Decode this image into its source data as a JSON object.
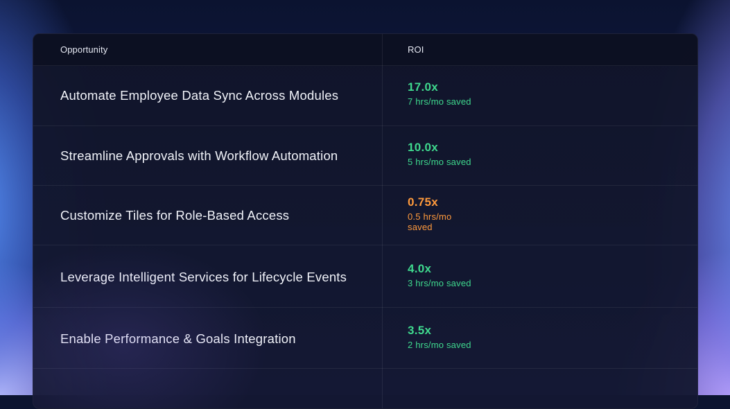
{
  "table": {
    "headers": {
      "opportunity": "Opportunity",
      "roi": "ROI"
    },
    "rows": [
      {
        "opportunity": "Automate Employee Data Sync Across Modules",
        "roi": "17.0x",
        "savings": "7 hrs/mo saved",
        "status_color": "#3fd98e"
      },
      {
        "opportunity": "Streamline Approvals with Workflow Automation",
        "roi": "10.0x",
        "savings": "5 hrs/mo saved",
        "status_color": "#3fd98e"
      },
      {
        "opportunity": "Customize Tiles for Role-Based Access",
        "roi": "0.75x",
        "savings": "0.5 hrs/mo saved",
        "status_color": "#ff9a3c"
      },
      {
        "opportunity": "Leverage Intelligent Services for Lifecycle Events",
        "roi": "4.0x",
        "savings": "3 hrs/mo saved",
        "status_color": "#3fd98e"
      },
      {
        "opportunity": "Enable Performance & Goals Integration",
        "roi": "3.5x",
        "savings": "2 hrs/mo saved",
        "status_color": "#3fd98e"
      }
    ]
  },
  "colors": {
    "positive": "#3fd98e",
    "warning": "#ff9a3c",
    "card_background": "#141830",
    "text_primary": "#f1f3f9"
  }
}
